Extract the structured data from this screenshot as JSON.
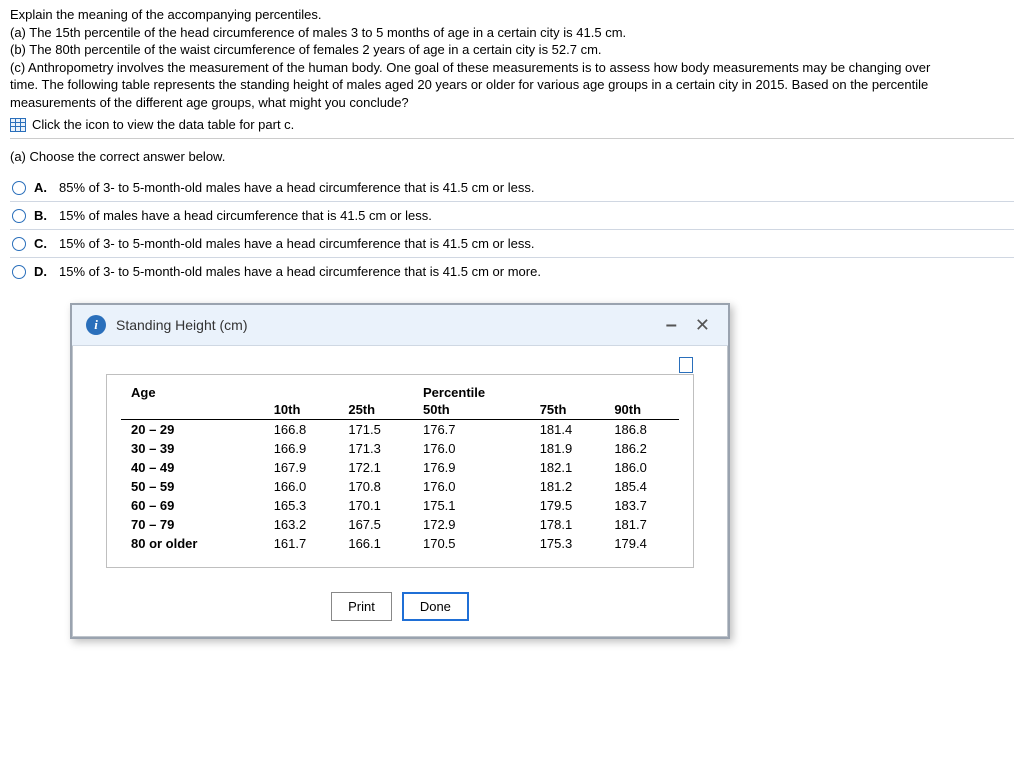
{
  "intro": {
    "line0": "Explain the meaning of the accompanying percentiles.",
    "line_a": "(a) The 15th percentile of the head circumference of males 3 to 5 months of age in a certain city is 41.5 cm.",
    "line_b": "(b) The 80th percentile of the waist circumference of females 2 years of age in a certain city is 52.7 cm.",
    "line_c1": "(c) Anthropometry involves the measurement of the human body. One goal of these measurements is to assess how body measurements may be changing over",
    "line_c2": "time. The following table represents the standing height of males aged 20 years or older for various age groups in a certain city in 2015. Based on the percentile",
    "line_c3": "measurements of the different age groups, what might you conclude?",
    "icon_link": "Click the icon to view the data table for part c."
  },
  "question_a": {
    "prompt": "(a) Choose the correct answer below.",
    "options": [
      {
        "letter": "A.",
        "text": "85% of 3- to 5-month-old males have a head circumference that is 41.5 cm or less."
      },
      {
        "letter": "B.",
        "text": "15% of males have a head circumference that is 41.5 cm or less."
      },
      {
        "letter": "C.",
        "text": "15% of 3- to 5-month-old males have a head circumference that is 41.5 cm or less."
      },
      {
        "letter": "D.",
        "text": "15% of 3- to 5-month-old males have a head circumference that is 41.5 cm or more."
      }
    ]
  },
  "modal": {
    "title": "Standing Height (cm)",
    "buttons": {
      "print": "Print",
      "done": "Done"
    },
    "table": {
      "age_header": "Age",
      "percentile_header": "Percentile",
      "cols": [
        "10th",
        "25th",
        "50th",
        "75th",
        "90th"
      ],
      "rows": [
        {
          "age": "20 – 29",
          "v": [
            "166.8",
            "171.5",
            "176.7",
            "181.4",
            "186.8"
          ]
        },
        {
          "age": "30 – 39",
          "v": [
            "166.9",
            "171.3",
            "176.0",
            "181.9",
            "186.2"
          ]
        },
        {
          "age": "40 – 49",
          "v": [
            "167.9",
            "172.1",
            "176.9",
            "182.1",
            "186.0"
          ]
        },
        {
          "age": "50 – 59",
          "v": [
            "166.0",
            "170.8",
            "176.0",
            "181.2",
            "185.4"
          ]
        },
        {
          "age": "60 – 69",
          "v": [
            "165.3",
            "170.1",
            "175.1",
            "179.5",
            "183.7"
          ]
        },
        {
          "age": "70 – 79",
          "v": [
            "163.2",
            "167.5",
            "172.9",
            "178.1",
            "181.7"
          ]
        },
        {
          "age": "80 or older",
          "v": [
            "161.7",
            "166.1",
            "170.5",
            "175.3",
            "179.4"
          ]
        }
      ]
    }
  },
  "chart_data": {
    "type": "table",
    "title": "Standing Height (cm)",
    "row_label": "Age",
    "col_label": "Percentile",
    "columns": [
      "10th",
      "25th",
      "50th",
      "75th",
      "90th"
    ],
    "rows": [
      "20 – 29",
      "30 – 39",
      "40 – 49",
      "50 – 59",
      "60 – 69",
      "70 – 79",
      "80 or older"
    ],
    "values": [
      [
        166.8,
        171.5,
        176.7,
        181.4,
        186.8
      ],
      [
        166.9,
        171.3,
        176.0,
        181.9,
        186.2
      ],
      [
        167.9,
        172.1,
        176.9,
        182.1,
        186.0
      ],
      [
        166.0,
        170.8,
        176.0,
        181.2,
        185.4
      ],
      [
        165.3,
        170.1,
        175.1,
        179.5,
        183.7
      ],
      [
        163.2,
        167.5,
        172.9,
        178.1,
        181.7
      ],
      [
        161.7,
        166.1,
        170.5,
        175.3,
        179.4
      ]
    ]
  }
}
